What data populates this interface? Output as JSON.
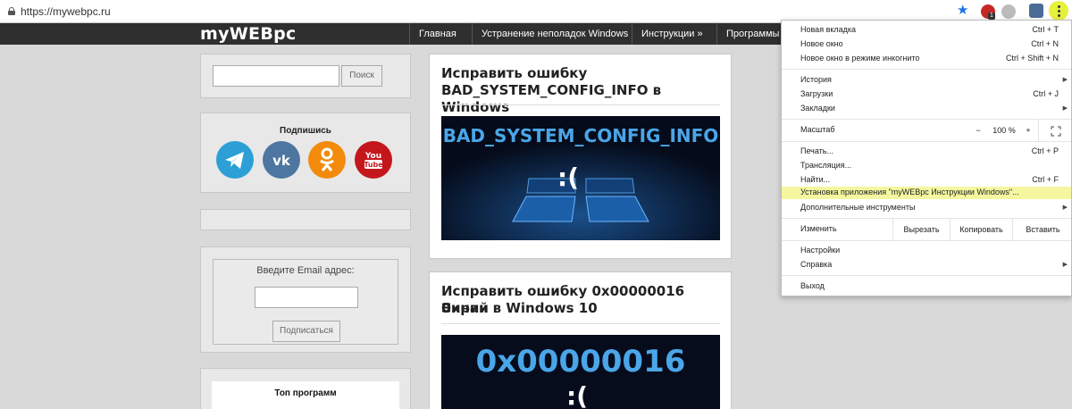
{
  "browser": {
    "url": "https://mywebpc.ru"
  },
  "site": {
    "logo": "myWEBpc",
    "nav": [
      "Главная",
      "Устранение неполадок Windows",
      "Инструкции »",
      "Программы »"
    ]
  },
  "sidebar": {
    "search_button": "Поиск",
    "subscribe_title": "Подпишись",
    "social": [
      "telegram-icon",
      "vk-icon",
      "odnoklassniki-icon",
      "youtube-icon"
    ],
    "youtube_text": "You Tube",
    "email_label": "Введите Email адрес:",
    "subscribe_button": "Подписаться",
    "top_programs": "Топ программ"
  },
  "articles": [
    {
      "title_line1": "Исправить ошибку",
      "title_line2": "BAD_SYSTEM_CONFIG_INFO в Windows",
      "image_text": "BAD_SYSTEM_CONFIG_INFO",
      "face": ":("
    },
    {
      "title_line1": "Исправить ошибку 0x00000016 Синий",
      "title_line2": "Экран в Windows 10",
      "image_text": "0x00000016",
      "face": ":("
    }
  ],
  "menu": {
    "new_tab": "Новая вкладка",
    "new_tab_sc": "Ctrl + T",
    "new_window": "Новое окно",
    "new_window_sc": "Ctrl + N",
    "incognito": "Новое окно в режиме инкогнито",
    "incognito_sc": "Ctrl + Shift + N",
    "history": "История",
    "downloads": "Загрузки",
    "downloads_sc": "Ctrl + J",
    "bookmarks": "Закладки",
    "zoom": "Масштаб",
    "zoom_minus": "−",
    "zoom_value": "100 %",
    "zoom_plus": "+",
    "print": "Печать...",
    "print_sc": "Ctrl + P",
    "cast": "Трансляция...",
    "find": "Найти...",
    "find_sc": "Ctrl + F",
    "install": "Установка приложения \"myWEBpc Инструкции Windows\"...",
    "more_tools": "Дополнительные инструменты",
    "edit": "Изменить",
    "cut": "Вырезать",
    "copy": "Копировать",
    "paste": "Вставить",
    "settings": "Настройки",
    "help": "Справка",
    "exit": "Выход"
  },
  "colors": {
    "highlight": "#f5f7a0",
    "telegram": "#2c9fd6",
    "vk": "#4d76a1",
    "ok": "#f28b0c",
    "youtube": "#c4171c"
  }
}
